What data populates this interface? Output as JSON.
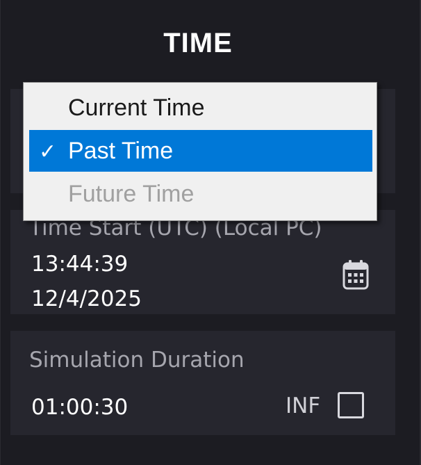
{
  "panel": {
    "title": "TIME"
  },
  "time_mode": {
    "options": [
      {
        "label": "Current Time",
        "selected": false,
        "enabled": true
      },
      {
        "label": "Past Time",
        "selected": true,
        "enabled": true
      },
      {
        "label": "Future Time",
        "selected": false,
        "enabled": false
      }
    ],
    "check_glyph": "✓"
  },
  "time_start": {
    "label": "Time Start (UTC) (Local PC)",
    "time": "13:44:39",
    "date": "12/4/2025",
    "icon": "calendar-icon"
  },
  "simulation_duration": {
    "label": "Simulation Duration",
    "value": "01:00:30",
    "inf_label": "INF",
    "inf_checked": false
  },
  "colors": {
    "background": "#1c1c22",
    "card": "#26262e",
    "selection": "#0078d7"
  }
}
